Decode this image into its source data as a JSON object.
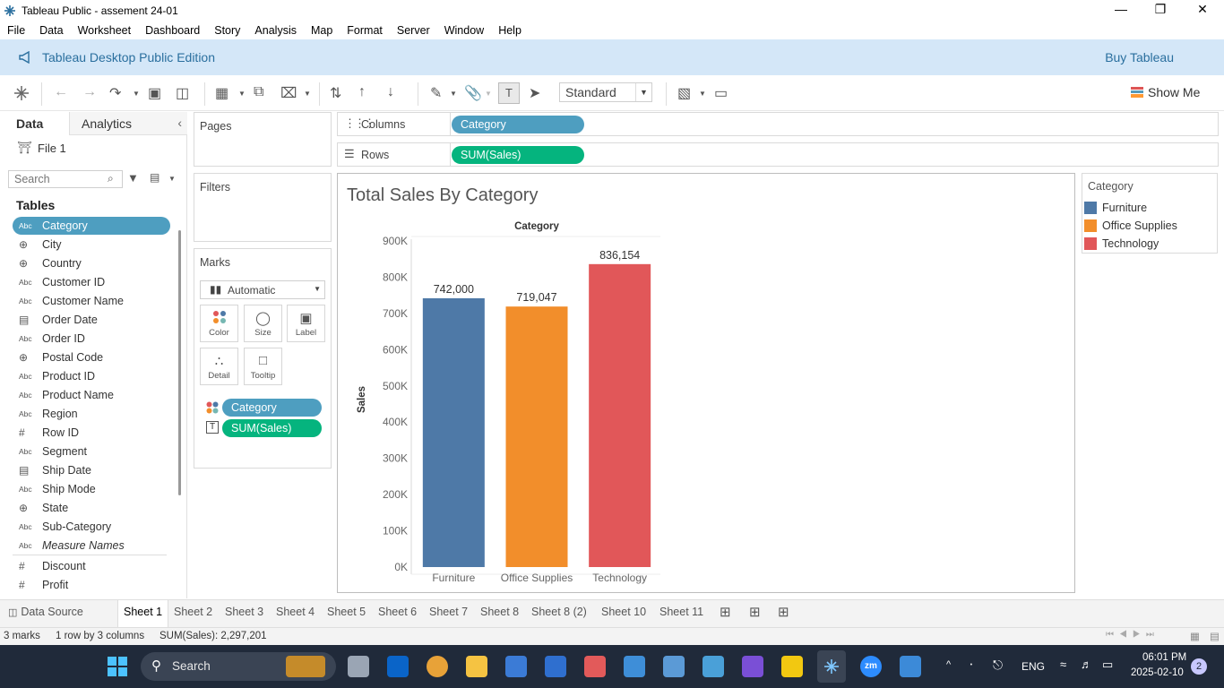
{
  "window": {
    "title": "Tableau Public - assement 24-01"
  },
  "menu": [
    "File",
    "Data",
    "Worksheet",
    "Dashboard",
    "Story",
    "Analysis",
    "Map",
    "Format",
    "Server",
    "Window",
    "Help"
  ],
  "banner": {
    "edition": "Tableau Desktop Public Edition",
    "buy": "Buy Tableau"
  },
  "toolbar": {
    "fit": "Standard",
    "show_me": "Show Me"
  },
  "datapane": {
    "tab_data": "Data",
    "tab_analytics": "Analytics",
    "source": "File 1",
    "search_placeholder": "Search",
    "tables_heading": "Tables",
    "fields": [
      {
        "type": "Abc",
        "name": "Category"
      },
      {
        "type": "globe",
        "name": "City"
      },
      {
        "type": "globe",
        "name": "Country"
      },
      {
        "type": "Abc",
        "name": "Customer ID"
      },
      {
        "type": "Abc",
        "name": "Customer Name"
      },
      {
        "type": "date",
        "name": "Order Date"
      },
      {
        "type": "Abc",
        "name": "Order ID"
      },
      {
        "type": "globe",
        "name": "Postal Code"
      },
      {
        "type": "Abc",
        "name": "Product ID"
      },
      {
        "type": "Abc",
        "name": "Product Name"
      },
      {
        "type": "Abc",
        "name": "Region"
      },
      {
        "type": "#",
        "name": "Row ID"
      },
      {
        "type": "Abc",
        "name": "Segment"
      },
      {
        "type": "date",
        "name": "Ship Date"
      },
      {
        "type": "Abc",
        "name": "Ship Mode"
      },
      {
        "type": "globe",
        "name": "State"
      },
      {
        "type": "Abc",
        "name": "Sub-Category"
      },
      {
        "type": "Abc",
        "name": "Measure Names"
      },
      {
        "type": "#",
        "name": "Discount"
      },
      {
        "type": "#",
        "name": "Profit"
      }
    ]
  },
  "shelves": {
    "pages": "Pages",
    "filters": "Filters",
    "marks": "Marks",
    "mark_type": "Automatic",
    "mark_buttons": [
      "Color",
      "Size",
      "Label",
      "Detail",
      "Tooltip"
    ],
    "mark_pills": [
      "Category",
      "SUM(Sales)"
    ],
    "columns_label": "Columns",
    "columns_pill": "Category",
    "rows_label": "Rows",
    "rows_pill": "SUM(Sales)"
  },
  "legend": {
    "title": "Category",
    "items": [
      {
        "name": "Furniture",
        "color": "#4e79a7"
      },
      {
        "name": "Office Supplies",
        "color": "#f28e2b"
      },
      {
        "name": "Technology",
        "color": "#e15759"
      }
    ]
  },
  "chart_data": {
    "type": "bar",
    "title": "Total Sales By Category",
    "xlabel": "Category",
    "ylabel": "Sales",
    "categories": [
      "Furniture",
      "Office Supplies",
      "Technology"
    ],
    "values": [
      742000,
      719047,
      836154
    ],
    "data_labels": [
      "742,000",
      "719,047",
      "836,154"
    ],
    "colors": [
      "#4e79a7",
      "#f28e2b",
      "#e15759"
    ],
    "ylim": [
      0,
      900000
    ],
    "yticks": [
      0,
      100000,
      200000,
      300000,
      400000,
      500000,
      600000,
      700000,
      800000,
      900000
    ],
    "ytick_labels": [
      "0K",
      "100K",
      "200K",
      "300K",
      "400K",
      "500K",
      "600K",
      "700K",
      "800K",
      "900K"
    ],
    "grid": false,
    "legend": "right"
  },
  "sheets": {
    "data_source": "Data Source",
    "tabs": [
      "Sheet 1",
      "Sheet 2",
      "Sheet 3",
      "Sheet 4",
      "Sheet 5",
      "Sheet 6",
      "Sheet 7",
      "Sheet 8",
      "Sheet 8 (2)",
      "Sheet 10",
      "Sheet 11"
    ],
    "active": "Sheet 1"
  },
  "status": {
    "marks": "3 marks",
    "dims": "1 row by 3 columns",
    "sum": "SUM(Sales): 2,297,201"
  },
  "taskbar": {
    "search": "Search",
    "lang": "ENG",
    "time": "06:01 PM",
    "date": "2025-02-10",
    "notif": "2"
  }
}
